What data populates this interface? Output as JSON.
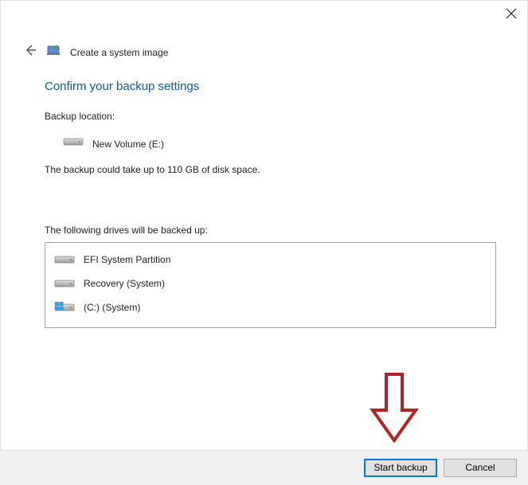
{
  "titlebar": {
    "close_label": "Close"
  },
  "header": {
    "back_label": "Back",
    "page_title": "Create a system image"
  },
  "main": {
    "heading": "Confirm your backup settings",
    "location_label": "Backup location:",
    "location_drive": "New Volume (E:)",
    "size_note": "The backup could take up to 110 GB of disk space.",
    "drives_label": "The following drives will be backed up:",
    "drives": [
      {
        "icon": "hdd",
        "label": "EFI System Partition"
      },
      {
        "icon": "hdd",
        "label": "Recovery (System)"
      },
      {
        "icon": "win-hdd",
        "label": "(C:) (System)"
      }
    ]
  },
  "footer": {
    "start_label": "Start backup",
    "cancel_label": "Cancel"
  }
}
